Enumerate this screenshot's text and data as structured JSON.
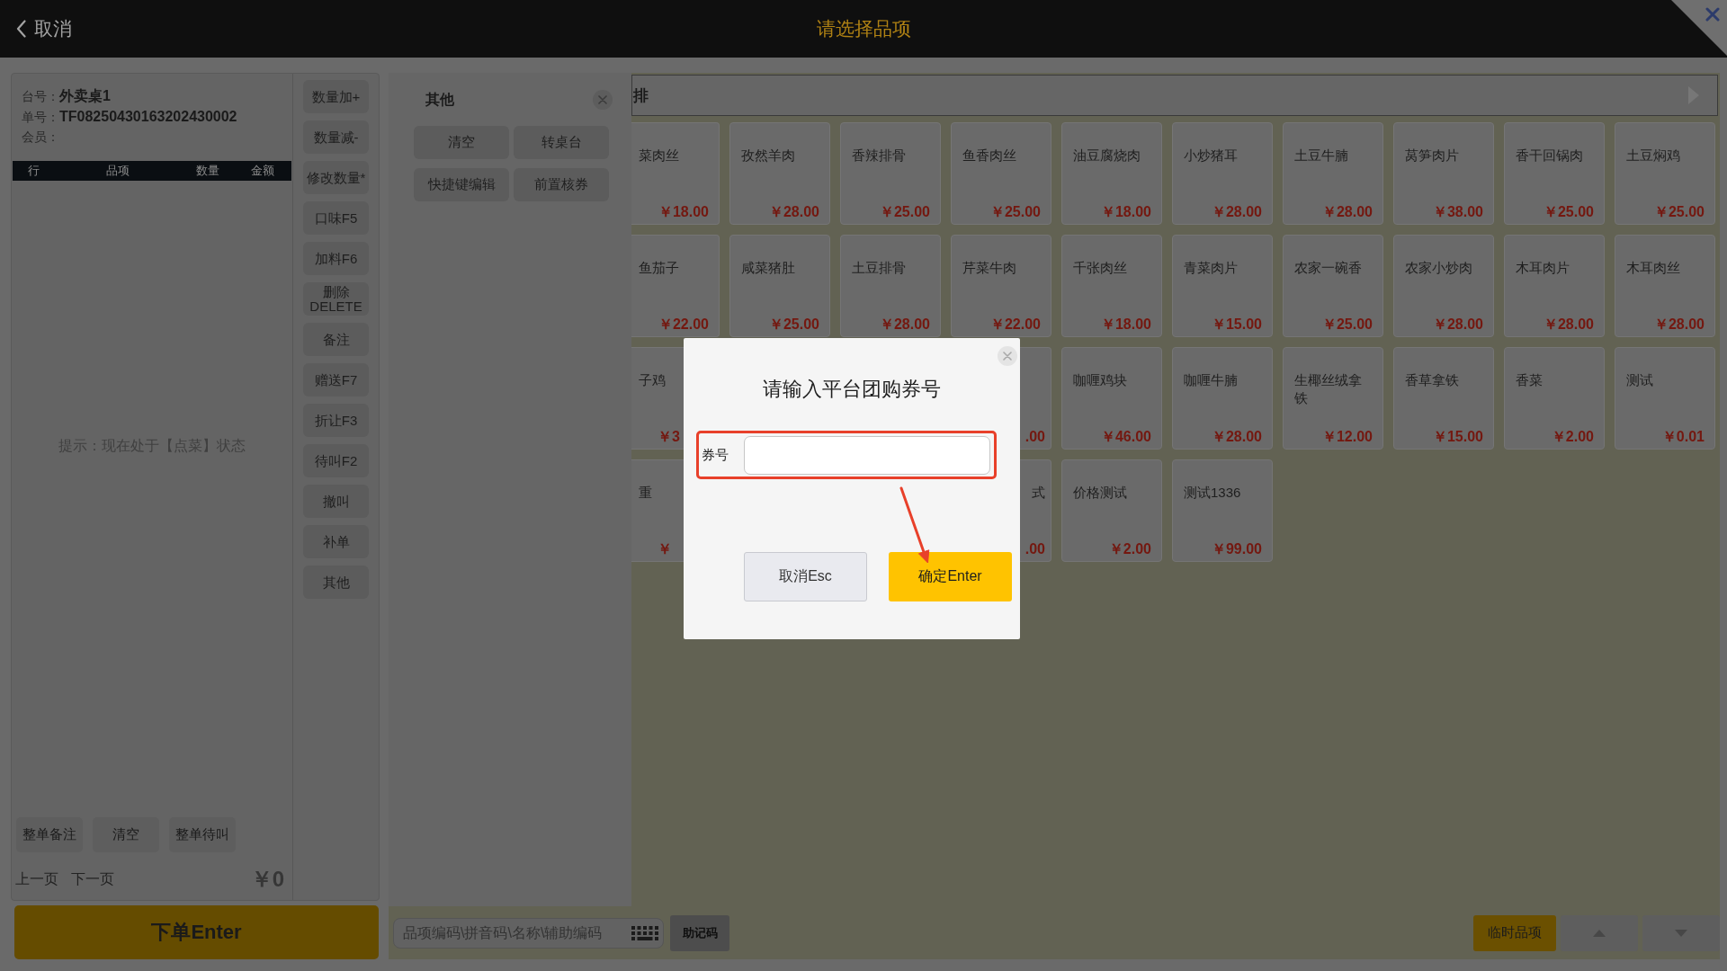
{
  "header": {
    "back_label": "取消",
    "title": "请选择品项"
  },
  "order_info": {
    "table_label": "台号：",
    "table": "外卖桌1",
    "order_label": "单号：",
    "order_no": "TF08250430163202430002",
    "member_label": "会员："
  },
  "order_table": {
    "columns": [
      "行",
      "品项",
      "数量",
      "金额"
    ],
    "hint": "提示：现在处于【点菜】状态"
  },
  "actions": [
    "数量加+",
    "数量减-",
    "修改数量*",
    "口味F5",
    "加料F6",
    "删除 DELETE",
    "备注",
    "赠送F7",
    "折让F3",
    "待叫F2",
    "撤叫",
    "补单",
    "其他"
  ],
  "order_buttons": [
    "整单备注",
    "清空",
    "整单待叫"
  ],
  "pager": {
    "prev": "上一页",
    "next": "下一页",
    "total": "￥0"
  },
  "submit_button": "下单Enter",
  "other_panel": {
    "title": "其他",
    "buttons": [
      "清空",
      "转桌台",
      "快捷键编辑",
      "前置核券"
    ]
  },
  "category_bar": {
    "label": "排"
  },
  "dishes": [
    {
      "kind": "cut_left",
      "name": "菜肉丝",
      "price": "￥18.00"
    },
    {
      "kind": "whole",
      "name": "孜然羊肉",
      "price": "￥28.00"
    },
    {
      "kind": "whole",
      "name": "香辣排骨",
      "price": "￥25.00"
    },
    {
      "kind": "whole",
      "name": "鱼香肉丝",
      "price": "￥25.00"
    },
    {
      "kind": "whole",
      "name": "油豆腐烧肉",
      "price": "￥18.00"
    },
    {
      "kind": "whole",
      "name": "小炒猪耳",
      "price": "￥28.00"
    },
    {
      "kind": "whole",
      "name": "土豆牛腩",
      "price": "￥28.00"
    },
    {
      "kind": "whole",
      "name": "莴笋肉片",
      "price": "￥38.00"
    },
    {
      "kind": "whole",
      "name": "香干回锅肉",
      "price": "￥25.00"
    },
    {
      "kind": "whole",
      "name": "土豆焖鸡",
      "price": "￥25.00"
    },
    {
      "kind": "cut_left",
      "name": "鱼茄子",
      "price": "￥22.00"
    },
    {
      "kind": "whole",
      "name": "咸菜猪肚",
      "price": "￥25.00"
    },
    {
      "kind": "whole",
      "name": "土豆排骨",
      "price": "￥28.00"
    },
    {
      "kind": "whole",
      "name": "芹菜牛肉",
      "price": "￥22.00"
    },
    {
      "kind": "whole",
      "name": "千张肉丝",
      "price": "￥18.00"
    },
    {
      "kind": "whole",
      "name": "青菜肉片",
      "price": "￥15.00"
    },
    {
      "kind": "whole",
      "name": "农家一碗香",
      "price": "￥25.00"
    },
    {
      "kind": "whole",
      "name": "农家小炒肉",
      "price": "￥28.00"
    },
    {
      "kind": "whole",
      "name": "木耳肉片",
      "price": "￥28.00"
    },
    {
      "kind": "whole",
      "name": "木耳肉丝",
      "price": "￥28.00"
    },
    {
      "kind": "strip_left",
      "name": "子鸡",
      "price": "￥3"
    },
    {
      "kind": "strip_right",
      "price": ".00"
    },
    {
      "kind": "whole",
      "name": "咖喱鸡块",
      "price": "￥46.00"
    },
    {
      "kind": "whole",
      "name": "咖喱牛腩",
      "price": "￥28.00"
    },
    {
      "kind": "whole",
      "name": "生椰丝绒拿铁",
      "price": "￥12.00"
    },
    {
      "kind": "whole",
      "name": "香草拿铁",
      "price": "￥15.00"
    },
    {
      "kind": "whole",
      "name": "香菜",
      "price": "￥2.00"
    },
    {
      "kind": "whole",
      "name": "测试",
      "price": "￥0.01"
    },
    {
      "kind": "strip_left",
      "name": "重",
      "price": "￥"
    },
    {
      "kind": "strip_right",
      "name": "式",
      "price": ".00"
    },
    {
      "kind": "whole",
      "name": "价格测试",
      "price": "￥2.00"
    },
    {
      "kind": "whole",
      "name": "测试1336",
      "price": "￥99.00"
    }
  ],
  "search": {
    "placeholder": "品项编码\\拼音码\\名称\\辅助编码"
  },
  "mnemonic_button": "助记码",
  "temp_item_button": "临时品项",
  "dialog": {
    "title": "请输入平台团购券号",
    "field_label": "券号",
    "cancel": "取消Esc",
    "confirm": "确定Enter"
  }
}
